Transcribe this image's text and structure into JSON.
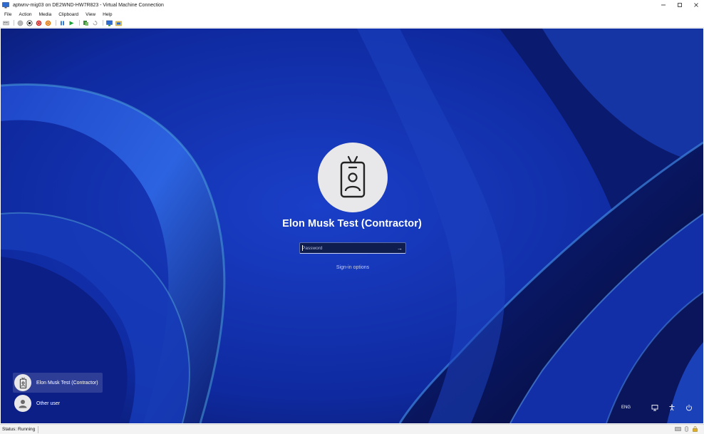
{
  "window": {
    "title": "aptwnv-mig03 on DE2WND-HW7R823 - Virtual Machine Connection",
    "controls": {
      "minimize": "—",
      "maximize": "☐",
      "close": "✕"
    }
  },
  "menu": {
    "items": [
      "File",
      "Action",
      "Media",
      "Clipboard",
      "View",
      "Help"
    ]
  },
  "toolbar": {
    "buttons": [
      "ctrl-alt-del",
      "start",
      "turn-off",
      "shut-down",
      "save",
      "pause",
      "reset",
      "checkpoint",
      "revert",
      "enhanced-session",
      "share"
    ]
  },
  "login": {
    "username": "Elon Musk Test (Contractor)",
    "password_placeholder": "Password",
    "password_value": "",
    "submit_glyph": "→",
    "signin_options": "Sign-in options"
  },
  "users": [
    {
      "label": "Elon Musk Test (Contractor)",
      "selected": true,
      "icon": "badge-icon"
    },
    {
      "label": "Other user",
      "selected": false,
      "icon": "person-icon"
    }
  ],
  "tray": {
    "language": "ENG",
    "icons": [
      "network-icon",
      "accessibility-icon",
      "power-icon"
    ]
  },
  "status": {
    "text": "Status: Running"
  },
  "colors": {
    "wallpaper_base": "#1030a8",
    "wallpaper_dark": "#0a1250",
    "wallpaper_light": "#3f7fe0",
    "avatar_bg": "#e8e8ea",
    "text_white": "#ffffff"
  }
}
